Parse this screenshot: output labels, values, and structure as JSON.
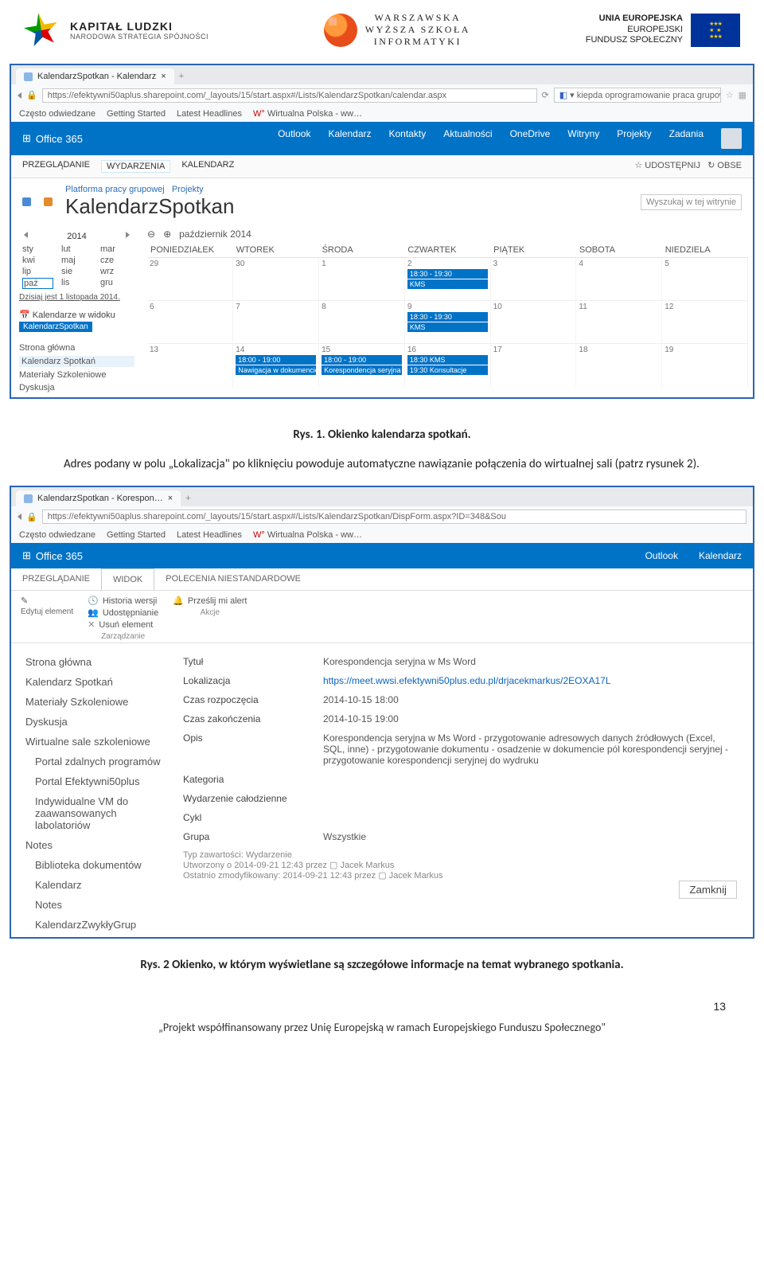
{
  "header": {
    "kl_title": "KAPITAŁ LUDZKI",
    "kl_sub": "NARODOWA STRATEGIA SPÓJNOŚCI",
    "wwsi_l1": "WARSZAWSKA",
    "wwsi_l2": "WYŻSZA SZKOŁA",
    "wwsi_l3": "INFORMATYKI",
    "ue_l1": "UNIA EUROPEJSKA",
    "ue_l2": "EUROPEJSKI",
    "ue_l3": "FUNDUSZ SPOŁECZNY",
    "ue_stars": "★ ★ ★ ★ ★"
  },
  "shot1": {
    "tab_title": "KalendarzSpotkan - Kalendarz",
    "tab_close": "×",
    "tab_plus": "+",
    "url": "https://efektywni50aplus.sharepoint.com/_layouts/15/start.aspx#/Lists/KalendarzSpotkan/calendar.aspx",
    "search_g": "kiepda oprogramowanie praca grupowa",
    "bookmarks": [
      "Często odwiedzane",
      "Getting Started",
      "Latest Headlines",
      "Wirtualna Polska - ww…"
    ],
    "o365": "Office 365",
    "o365nav": [
      "Outlook",
      "Kalendarz",
      "Kontakty",
      "Aktualności",
      "OneDrive",
      "Witryny",
      "Projekty",
      "Zadania"
    ],
    "ribbon": {
      "t1": "PRZEGLĄDANIE",
      "t2": "WYDARZENIA",
      "t3": "KALENDARZ",
      "share": "UDOSTĘPNIJ",
      "obs": "OBSE"
    },
    "crumb1": "Platforma pracy grupowej",
    "crumb2": "Projekty",
    "title": "KalendarzSpotkan",
    "search_site": "Wyszukaj w tej witrynie",
    "year": "2014",
    "months": [
      "sty",
      "lut",
      "mar",
      "kwi",
      "maj",
      "cze",
      "lip",
      "sie",
      "wrz",
      "paź",
      "lis",
      "gru"
    ],
    "today": "Dzisiaj jest 1 listopada 2014.",
    "cal_in_view": "Kalendarze w widoku",
    "cal_in_view_item": "KalendarzSpotkan",
    "sidenav": [
      "Strona główna",
      "Kalendarz Spotkań",
      "Materiały Szkoleniowe",
      "Dyskusja"
    ],
    "cal_month": "październik 2014",
    "days": [
      "PONIEDZIAŁEK",
      "WTOREK",
      "ŚRODA",
      "CZWARTEK",
      "PIĄTEK",
      "SOBOTA",
      "NIEDZIELA"
    ],
    "cells": {
      "r1": [
        "29",
        "30",
        "1",
        "2",
        "3",
        "4",
        "5"
      ],
      "r2": [
        "6",
        "7",
        "8",
        "9",
        "10",
        "11",
        "12"
      ],
      "r3": [
        "13",
        "14",
        "15",
        "16",
        "17",
        "18",
        "19"
      ]
    },
    "evt_kms_time": "18:30 - 19:30",
    "evt_kms": "KMS",
    "evt_14_time": "18:00 - 19:00",
    "evt_14": "Nawigacja w dokumencie",
    "evt_15_time": "18:00 - 19:00",
    "evt_15": "Korespondencja seryjna w",
    "evt_16a": "18:30 KMS",
    "evt_16b": "19:30 Konsultacje"
  },
  "caption1": "Rys. 1. Okienko kalendarza spotkań.",
  "para1": "Adres podany w polu „Lokalizacja\" po kliknięciu powoduje automatyczne nawiązanie połączenia do wirtualnej sali (patrz rysunek 2).",
  "shot2": {
    "tab_title": "KalendarzSpotkan - Korespon…",
    "tab_close": "×",
    "tab_plus": "+",
    "url": "https://efektywni50aplus.sharepoint.com/_layouts/15/start.aspx#/Lists/KalendarzSpotkan/DispForm.aspx?ID=348&Sou",
    "bookmarks": [
      "Często odwiedzane",
      "Getting Started",
      "Latest Headlines",
      "Wirtualna Polska - ww…"
    ],
    "o365": "Office 365",
    "o365nav": [
      "Outlook",
      "Kalendarz"
    ],
    "ribbon_tabs": [
      "PRZEGLĄDANIE",
      "WIDOK",
      "POLECENIA NIESTANDARDOWE"
    ],
    "rb": {
      "edit": "Edytuj element",
      "history": "Historia wersji",
      "share": "Udostępnianie",
      "delete": "Usuń element",
      "alert": "Prześlij mi alert",
      "g1": "Zarządzanie",
      "g2": "Akcje"
    },
    "leftnav": [
      "Strona główna",
      "Kalendarz Spotkań",
      "Materiały Szkoleniowe",
      "Dyskusja",
      "Wirtualne sale szkoleniowe",
      "Portal zdalnych programów",
      "Portal Efektywni50plus",
      "Indywidualne VM do zaawansowanych labolatoriów",
      "Notes",
      "Biblioteka dokumentów",
      "Kalendarz",
      "Notes",
      "KalendarzZwykłyGrup"
    ],
    "fields": {
      "tytul_k": "Tytuł",
      "tytul_v": "Korespondencja seryjna w Ms Word",
      "lok_k": "Lokalizacja",
      "lok_v": "https://meet.wwsi.efektywni50plus.edu.pl/drjacekmarkus/2EOXA17L",
      "roz_k": "Czas rozpoczęcia",
      "roz_v": "2014-10-15 18:00",
      "zak_k": "Czas zakończenia",
      "zak_v": "2014-10-15 19:00",
      "opis_k": "Opis",
      "opis_v": "Korespondencja seryjna w Ms Word - przygotowanie adresowych danych źródłowych (Excel, SQL, inne) - przygotowanie dokumentu - osadzenie w dokumencie pól korespondencji seryjnej - przygotowanie korespondencji seryjnej do wydruku",
      "kat_k": "Kategoria",
      "calodz_k": "Wydarzenie całodzienne",
      "cykl_k": "Cykl",
      "grupa_k": "Grupa",
      "grupa_v": "Wszystkie"
    },
    "meta1": "Typ zawartości: Wydarzenie",
    "meta2": "Utworzony o 2014-09-21 12:43 przez ▢ Jacek Markus",
    "meta3": "Ostatnio zmodyfikowany: 2014-09-21 12:43 przez ▢ Jacek Markus",
    "close": "Zamknij"
  },
  "caption2": "Rys. 2 Okienko, w którym wyświetlane są szczegółowe informacje na temat wybranego spotkania.",
  "pagenum": "13",
  "footer": "„Projekt współfinansowany przez Unię Europejską w ramach Europejskiego Funduszu Społecznego\""
}
